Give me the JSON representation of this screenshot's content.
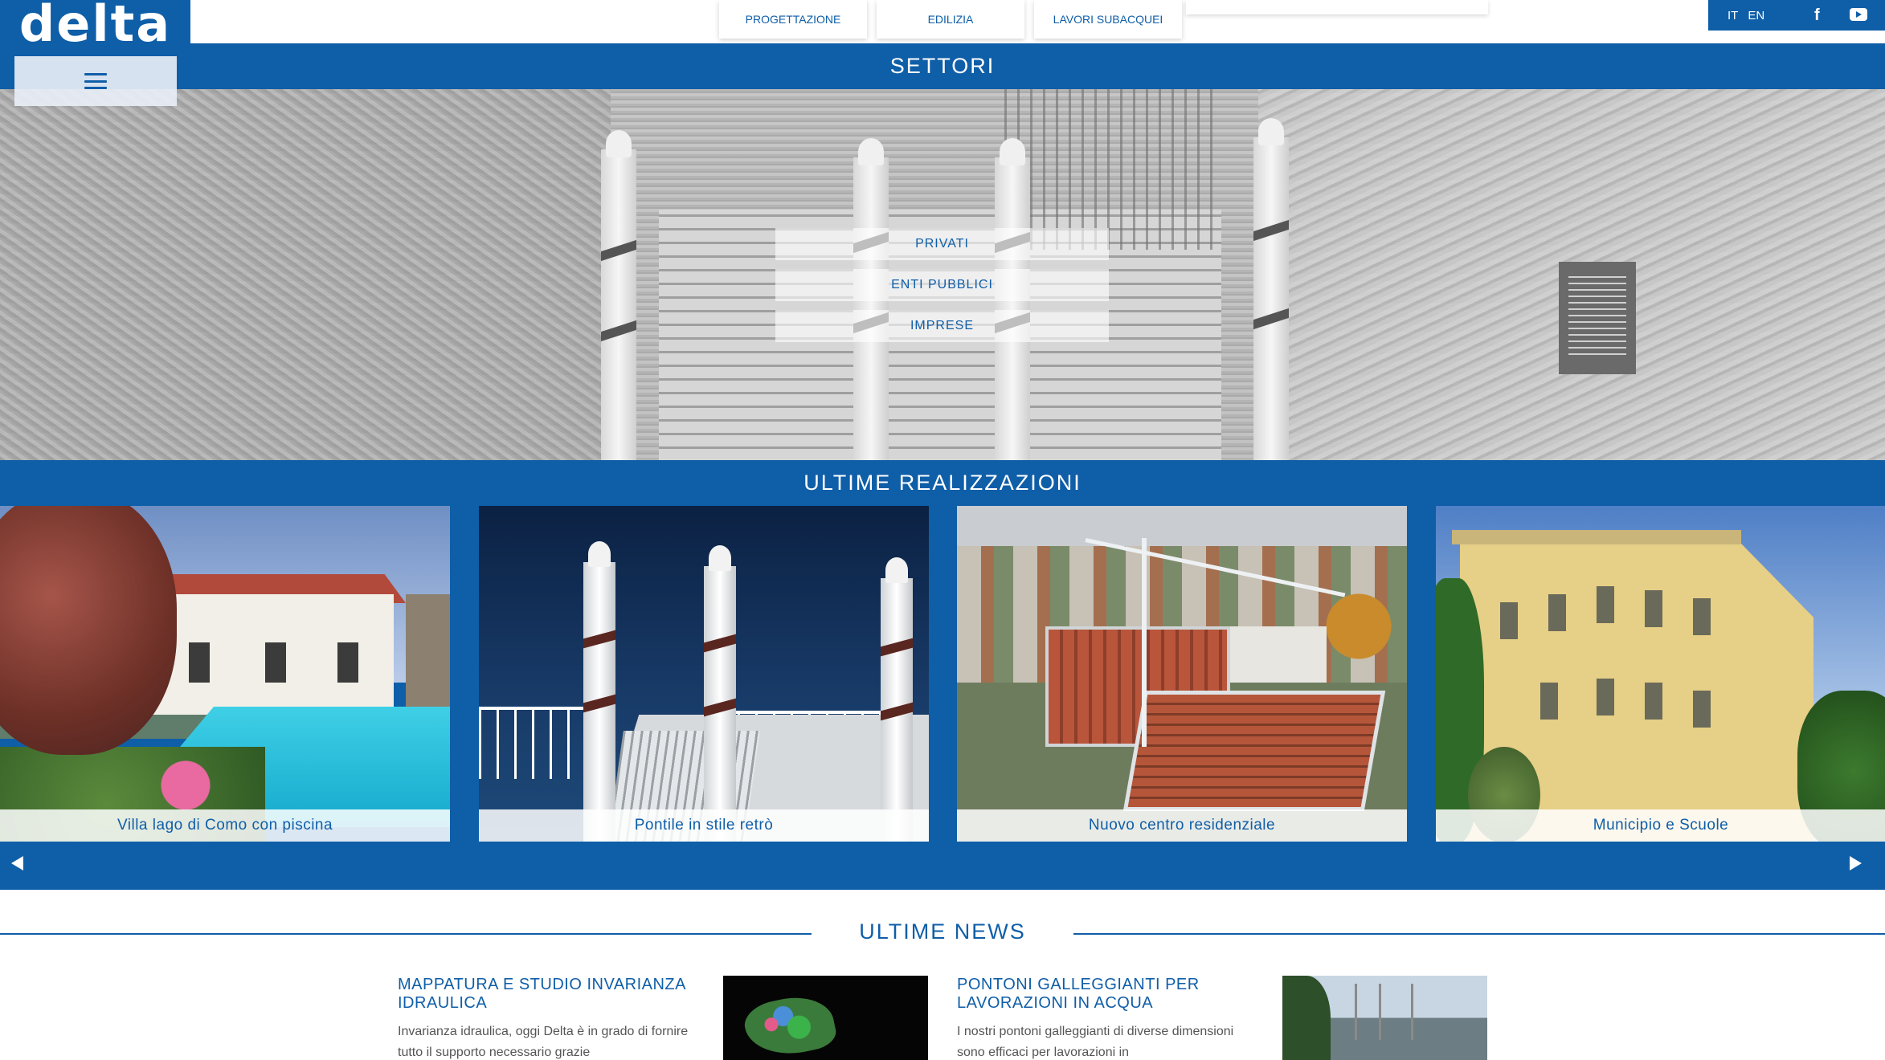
{
  "brand": {
    "logo_text": "delta",
    "color_primary": "#0f5ea8"
  },
  "menu": {
    "icon": "hamburger-icon"
  },
  "top_nav": {
    "tabs": [
      {
        "label": "PROGETTAZIONE"
      },
      {
        "label": "EDILIZIA"
      },
      {
        "label": "LAVORI SUBACQUEI"
      }
    ]
  },
  "lang": {
    "it": "IT",
    "en": "EN"
  },
  "social": {
    "facebook_icon": "facebook-icon",
    "facebook_glyph": "f",
    "youtube_icon": "youtube-icon"
  },
  "sectors": {
    "title": "SETTORI",
    "items": [
      {
        "label": "PRIVATI"
      },
      {
        "label": "ENTI PUBBLICI"
      },
      {
        "label": "IMPRESE"
      }
    ]
  },
  "projects": {
    "title": "ULTIME REALIZZAZIONI",
    "items": [
      {
        "caption": "Villa lago di Como con piscina"
      },
      {
        "caption": "Pontile in stile retrò"
      },
      {
        "caption": "Nuovo centro residenziale"
      },
      {
        "caption": "Municipio e Scuole"
      }
    ],
    "prev_icon": "arrow-left-icon",
    "next_icon": "arrow-right-icon"
  },
  "news": {
    "title": "ULTIME NEWS",
    "items": [
      {
        "title": "MAPPATURA E STUDIO INVARIANZA IDRAULICA",
        "excerpt": "Invarianza idraulica, oggi Delta è in grado di fornire tutto il supporto necessario grazie"
      },
      {
        "title": "PONTONI GALLEGGIANTI PER LAVORAZIONI IN ACQUA",
        "excerpt": "I nostri pontoni galleggianti di diverse dimensioni sono efficaci per lavorazioni in"
      }
    ]
  }
}
